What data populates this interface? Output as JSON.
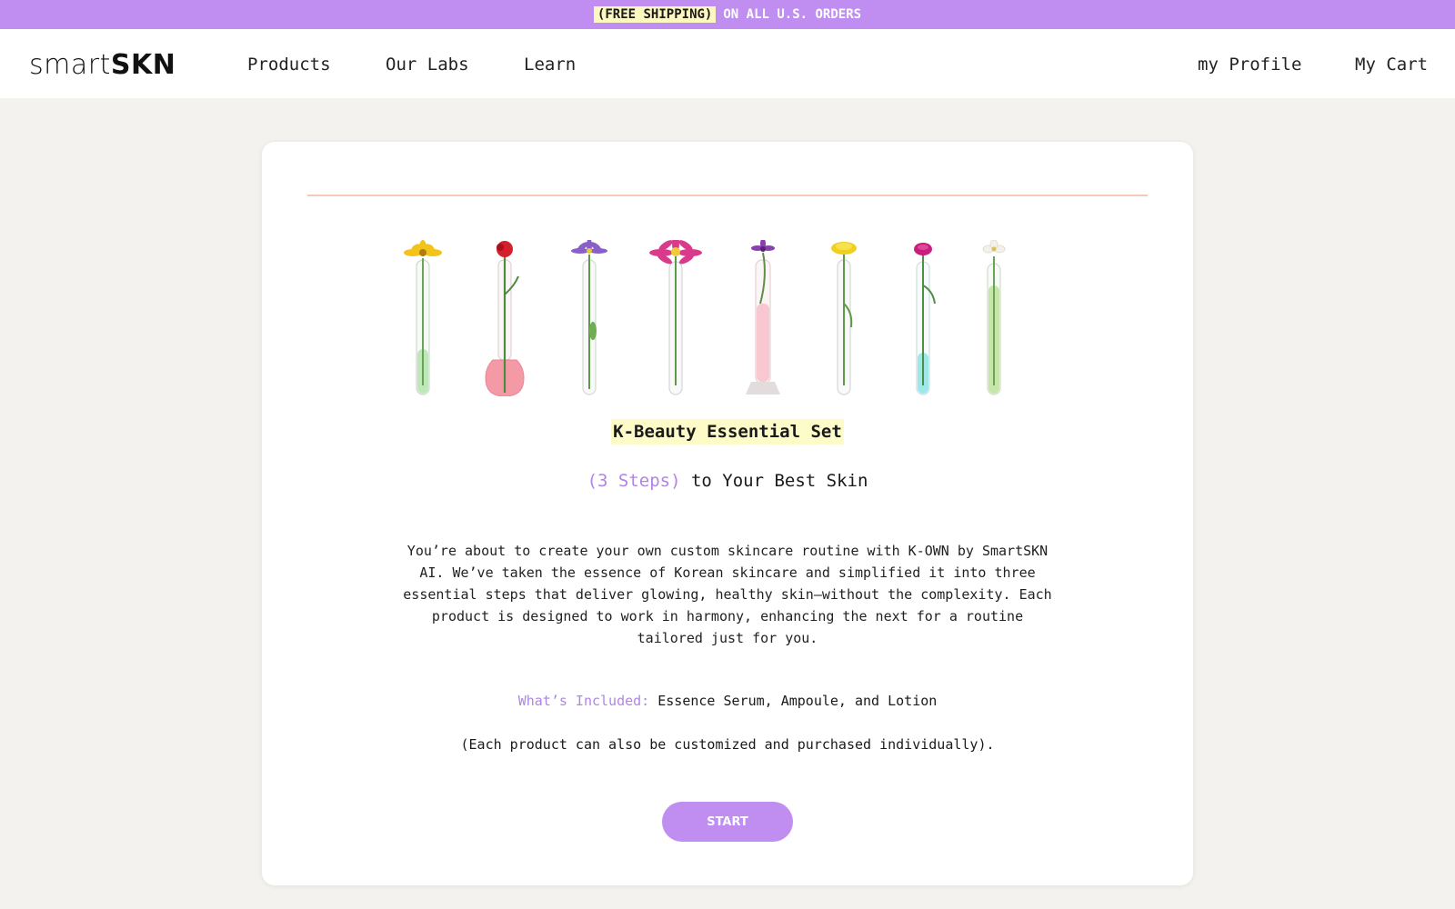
{
  "promo": {
    "highlight": "(FREE SHIPPING)",
    "rest": "ON ALL U.S. ORDERS"
  },
  "nav": {
    "logo_light": "smart",
    "logo_bold": "SKN",
    "links": [
      "Products",
      "Our Labs",
      "Learn"
    ],
    "profile": "my Profile",
    "cart": "My Cart"
  },
  "hero": {
    "flowers": [
      {
        "flower": "yellow daisy",
        "liquid": "light green"
      },
      {
        "flower": "red rose",
        "liquid": "pink"
      },
      {
        "flower": "purple aster",
        "liquid": "clear"
      },
      {
        "flower": "magenta gerbera",
        "liquid": "clear"
      },
      {
        "flower": "purple cornflower",
        "liquid": "light pink"
      },
      {
        "flower": "yellow carnation",
        "liquid": "clear"
      },
      {
        "flower": "magenta carnation",
        "liquid": "aqua"
      },
      {
        "flower": "white flower",
        "liquid": "green"
      }
    ],
    "title": "K-Beauty Essential Set",
    "subtitle_accent": "(3 Steps)",
    "subtitle_rest": " to Your Best Skin",
    "description": "You’re about to create your own custom skincare routine with K-OWN by SmartSKN AI. We’ve taken the essence of Korean skincare and simplified it into three essential steps that deliver glowing, healthy skin—without the complexity. Each product is designed to work in harmony, enhancing the next for a routine tailored just for you.",
    "included_label": "What’s Included:",
    "included_value": " Essence Serum, Ampoule, and Lotion",
    "note": "(Each product can also be customized and purchased individually).",
    "start_label": "START"
  },
  "colors": {
    "accent": "#bf8ef0",
    "highlight": "#fdf7c0",
    "divider": "#f4c9b8",
    "background": "#f3f2ee"
  }
}
